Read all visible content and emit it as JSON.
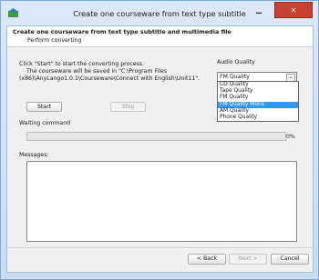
{
  "window": {
    "title": "Create one courseware from text type subtitle"
  },
  "header": {
    "title": "Create one courseware from text type subtitle and multimedia file",
    "subtitle": "Perform converting"
  },
  "instructions": {
    "line1": "Click \"Start\" to start the converting process.",
    "line2": "The courseware will be saved in \"C:\\Program Files",
    "line3": "(x86)\\AnyLango1.0.1\\Courseware\\Connect with English\\Unit11\"."
  },
  "buttons": {
    "start": "Start",
    "stop": "Stop",
    "back": "< Back",
    "next": "Next >",
    "cancel": "Cancel"
  },
  "audio_quality": {
    "label": "Audio Quality",
    "selected": "FM Quality",
    "options": [
      "CD Quality",
      "Tape Quality",
      "FM Quality",
      "FM Quality Mono",
      "AM Quality",
      "Phone Quality"
    ],
    "highlighted": "FM Quality Mono"
  },
  "progress": {
    "label": "Waiting command",
    "percent_text": "0%",
    "value": 0
  },
  "messages": {
    "label": "Messages:"
  },
  "colors": {
    "highlight": "#3399ff",
    "close_button": "#c84030"
  }
}
